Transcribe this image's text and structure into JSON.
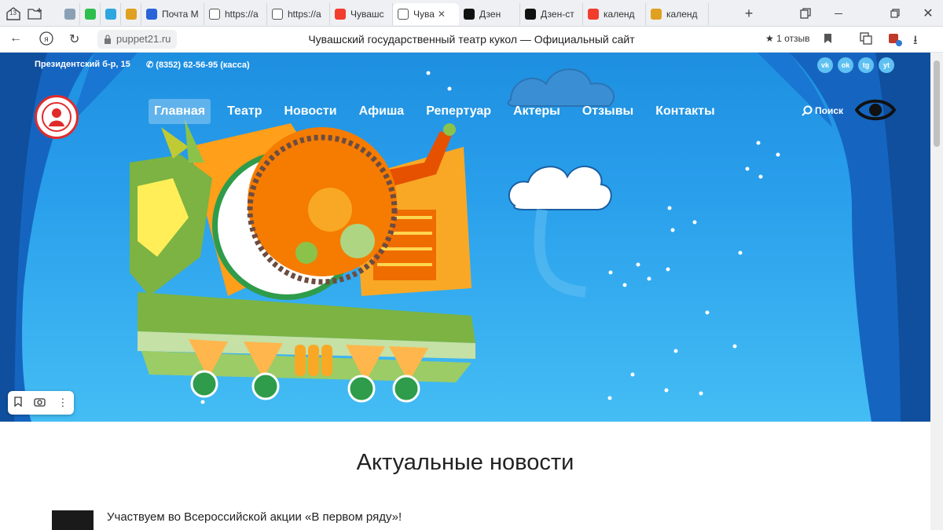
{
  "browser": {
    "tab_count_badge": "13",
    "tabs": [
      {
        "label": "",
        "icon": "globe-icon",
        "color": "#8aa0b4"
      },
      {
        "label": "",
        "icon": "whatsapp-icon",
        "color": "#2fbf4e"
      },
      {
        "label": "",
        "icon": "telegram-icon",
        "color": "#2ea6e0"
      },
      {
        "label": "",
        "icon": "shield-icon",
        "color": "#e0a020"
      },
      {
        "label": "Почта М",
        "icon": "mail-icon",
        "color": "#2b63d9"
      },
      {
        "label": "https://a",
        "icon": "page-icon",
        "color": "#ffffff"
      },
      {
        "label": "https://a",
        "icon": "page-icon",
        "color": "#ffffff"
      },
      {
        "label": "Чувашс",
        "icon": "yandex-icon",
        "color": "#f23c2e"
      },
      {
        "label": "Чува",
        "icon": "page-icon",
        "color": "#ffffff",
        "active": true
      },
      {
        "label": "Дзен",
        "icon": "dzen-icon",
        "color": "#111111"
      },
      {
        "label": "Дзен-ст",
        "icon": "dzen-icon",
        "color": "#111111"
      },
      {
        "label": "календ",
        "icon": "yandex-icon",
        "color": "#f23c2e"
      },
      {
        "label": "календ",
        "icon": "image-icon",
        "color": "#e0a020"
      }
    ],
    "url": "puppet21.ru",
    "page_title": "Чувашский государственный театр кукол — Официальный сайт",
    "reviews_label": "1 отзыв"
  },
  "site": {
    "address": "Президентский б-р, 15",
    "phone": "(8352) 62-56-95 (касса)",
    "social": [
      {
        "label": "vk",
        "icon": "vk-icon"
      },
      {
        "label": "ok",
        "icon": "odnoklassniki-icon"
      },
      {
        "label": "tg",
        "icon": "telegram-icon"
      },
      {
        "label": "yt",
        "icon": "youtube-icon"
      }
    ],
    "nav": [
      {
        "label": "Главная",
        "active": true
      },
      {
        "label": "Театр"
      },
      {
        "label": "Новости"
      },
      {
        "label": "Афиша"
      },
      {
        "label": "Репертуар"
      },
      {
        "label": "Актеры"
      },
      {
        "label": "Отзывы"
      },
      {
        "label": "Контакты"
      }
    ],
    "search_label": "Поиск",
    "colors": {
      "sky_top": "#1e8fe0",
      "sky_bottom": "#44bdf4",
      "curtain": "#1565c0",
      "logo_red": "#e02b2b"
    }
  },
  "news": {
    "title": "Актуальные новости",
    "items": [
      {
        "title": "Участвуем во Всероссийской акции «В первом ряду»!"
      }
    ]
  }
}
